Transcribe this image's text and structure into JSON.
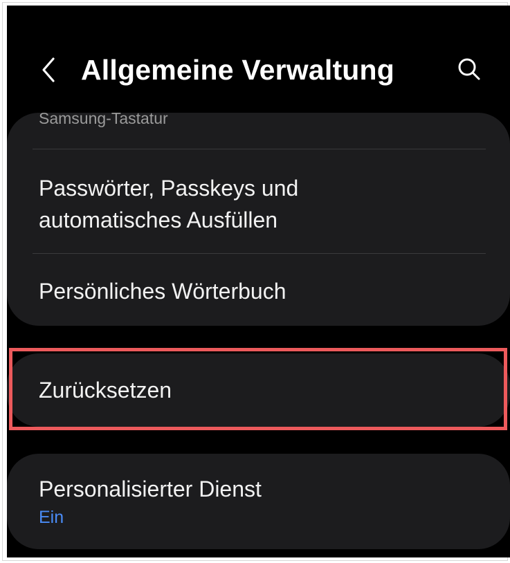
{
  "header": {
    "title": "Allgemeine Verwaltung",
    "back_icon": "chevron-left-icon",
    "search_icon": "search-icon"
  },
  "groups": [
    {
      "items": [
        {
          "label": "Samsung-Tastatur",
          "partial": true
        },
        {
          "label_line1": "Passwörter, Passkeys und",
          "label_line2": "automatisches Ausfüllen"
        },
        {
          "label": "Persönliches Wörterbuch"
        }
      ]
    },
    {
      "items": [
        {
          "label": "Zurücksetzen",
          "highlighted": true
        }
      ]
    },
    {
      "items": [
        {
          "label": "Personalisierter Dienst",
          "sublabel": "Ein"
        }
      ]
    }
  ],
  "colors": {
    "background": "#000000",
    "card": "#1c1c1e",
    "text": "#f2f2f2",
    "secondary_text": "#9a9a9a",
    "accent_blue": "#4a8cf7",
    "highlight_border": "#ec5a5c"
  }
}
